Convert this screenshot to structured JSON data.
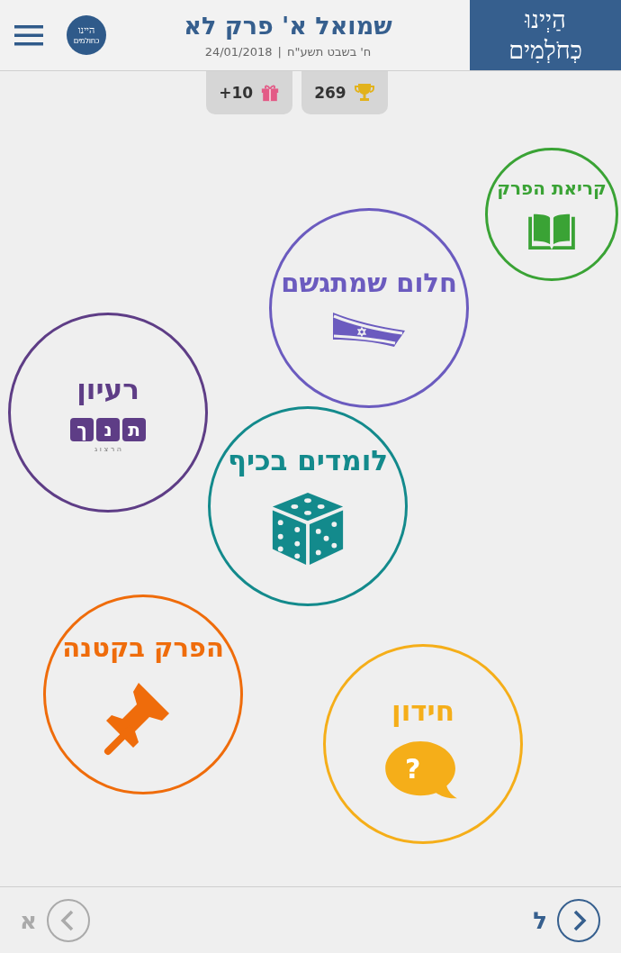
{
  "header": {
    "title": "שמואל א' פרק לא",
    "hebrew_date": "ח' בשבט תשע\"ח",
    "separator": "|",
    "date": "24/01/2018",
    "logo": [
      "הַיְינוּ",
      "כְּחֹלְמִים"
    ],
    "round_logo": [
      "היינו",
      "כחולמים"
    ]
  },
  "badges": [
    {
      "kind": "trophy",
      "value": "269"
    },
    {
      "kind": "gift",
      "value": "+10"
    }
  ],
  "activities": [
    {
      "title": "קריאת הפרק",
      "color": "#3aa335",
      "kind": "book"
    },
    {
      "title": "חלום שמתגשם",
      "color": "#6b5bbf",
      "kind": "flag"
    },
    {
      "title": "רעיון",
      "color": "#5e3d86",
      "kind": "tanach",
      "letters": [
        "ת",
        "נ",
        "ך"
      ],
      "subtitle": "ה ר צ ו ג"
    },
    {
      "title": "לומדים בכיף",
      "color": "#138a8c",
      "kind": "dice"
    },
    {
      "title": "הפרק בקטנה",
      "color": "#ef6c0b",
      "kind": "pin"
    },
    {
      "title": "חידון",
      "color": "#f5ae19",
      "kind": "quiz",
      "symbol": "?"
    }
  ],
  "nav": {
    "next": {
      "label": "ל",
      "disabled": false
    },
    "prev": {
      "label": "א",
      "disabled": true
    }
  }
}
